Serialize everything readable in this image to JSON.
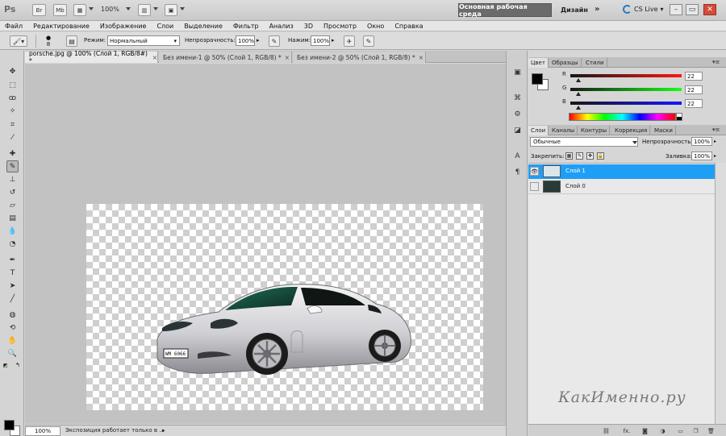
{
  "appbar": {
    "logo": "Ps",
    "bridge_label": "Br",
    "minibridge_label": "Mb",
    "zoom": "100%",
    "workspace": "Основная рабочая среда",
    "design": "Дизайн",
    "more": "»",
    "cslive": "CS Live",
    "win_minimize": "–",
    "win_restore": "▭",
    "win_close": "✕"
  },
  "menu": [
    "Файл",
    "Редактирование",
    "Изображение",
    "Слои",
    "Выделение",
    "Фильтр",
    "Анализ",
    "3D",
    "Просмотр",
    "Окно",
    "Справка"
  ],
  "options": {
    "brush_size": "8",
    "mode_label": "Режим:",
    "mode_value": "Нормальный",
    "opacity_label": "Непрозрачность:",
    "opacity_value": "100%",
    "pressure_label": "Нажим:",
    "pressure_value": "100%"
  },
  "tabs": [
    {
      "label": "porsche.jpg @ 100% (Слой 1, RGB/8#) *",
      "close": "×"
    },
    {
      "label": "Без имени-1 @ 50% (Слой 1, RGB/8) *",
      "close": "×"
    },
    {
      "label": "Без имени-2 @ 50% (Слой 1, RGB/8) *",
      "close": "×"
    }
  ],
  "status": {
    "zoom": "100%",
    "info": "Экспозиция работает только в ...",
    "arrow": "▸"
  },
  "color_panel": {
    "tabs": [
      "Цвет",
      "Образцы",
      "Стили"
    ],
    "channels": [
      {
        "label": "R",
        "value": "22"
      },
      {
        "label": "G",
        "value": "22"
      },
      {
        "label": "B",
        "value": "22"
      }
    ]
  },
  "layers_panel": {
    "tabs": [
      "Слои",
      "Каналы",
      "Контуры",
      "Коррекция",
      "Маски"
    ],
    "blend_mode": "Обычные",
    "opacity_label": "Непрозрачность:",
    "opacity_value": "100%",
    "lock_label": "Закрепить:",
    "fill_label": "Заливка:",
    "fill_value": "100%",
    "layers": [
      {
        "name": "Слой 1",
        "visible": true,
        "selected": true
      },
      {
        "name": "Слой 0",
        "visible": false,
        "selected": false
      }
    ],
    "footer_icons": [
      "link-icon",
      "fx-icon",
      "mask-icon",
      "adjustment-icon",
      "folder-icon",
      "new-layer-icon",
      "trash-icon"
    ],
    "footer_fx": "fx."
  },
  "watermark": "КакИменно.ру",
  "colors": {
    "accent": "#1f9ef5",
    "workspace_button": "#6b6b6b"
  }
}
